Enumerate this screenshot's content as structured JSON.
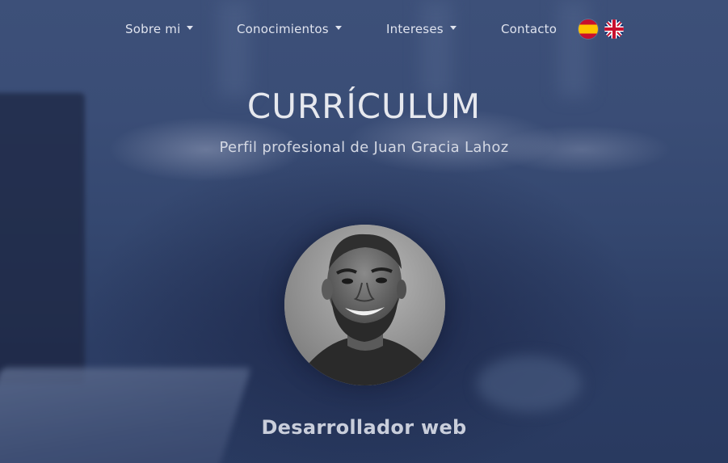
{
  "nav": {
    "items": [
      {
        "label": "Sobre mi",
        "dropdown": true
      },
      {
        "label": "Conocimientos",
        "dropdown": true
      },
      {
        "label": "Intereses",
        "dropdown": true
      },
      {
        "label": "Contacto",
        "dropdown": false
      }
    ],
    "languages": [
      {
        "icon": "spain-flag-icon"
      },
      {
        "icon": "uk-flag-icon"
      }
    ]
  },
  "hero": {
    "title": "CURRÍCULUM",
    "subtitle": "Perfil profesional de Juan Gracia Lahoz",
    "role": "Desarrollador web"
  },
  "colors": {
    "background": "#33466f",
    "nav_text": "#dfe3ee",
    "title_text": "#e6e8ee"
  }
}
